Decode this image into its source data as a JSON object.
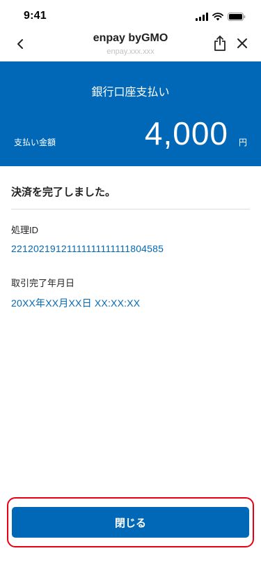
{
  "status_bar": {
    "time": "9:41",
    "icons": [
      "signal-icon",
      "wifi-icon",
      "battery-icon"
    ]
  },
  "nav": {
    "back_icon": "chevron-left-icon",
    "title": "enpay byGMO",
    "subtitle": "enpay.xxx.xxx",
    "share_icon": "share-icon",
    "close_icon": "close-icon"
  },
  "header": {
    "title": "銀行口座支払い",
    "amount_label": "支払い金額",
    "amount": "4,000",
    "unit": "円",
    "color": "#0068b7"
  },
  "result": {
    "message": "決済を完了しました。",
    "processing_id_label": "処理ID",
    "processing_id": "22120219121111111111111804585",
    "completed_at_label": "取引完了年月日",
    "completed_at": "20XX年XX月XX日 XX:XX:XX"
  },
  "footer": {
    "close_button_label": "閉じる",
    "highlight_color": "#e60012"
  }
}
